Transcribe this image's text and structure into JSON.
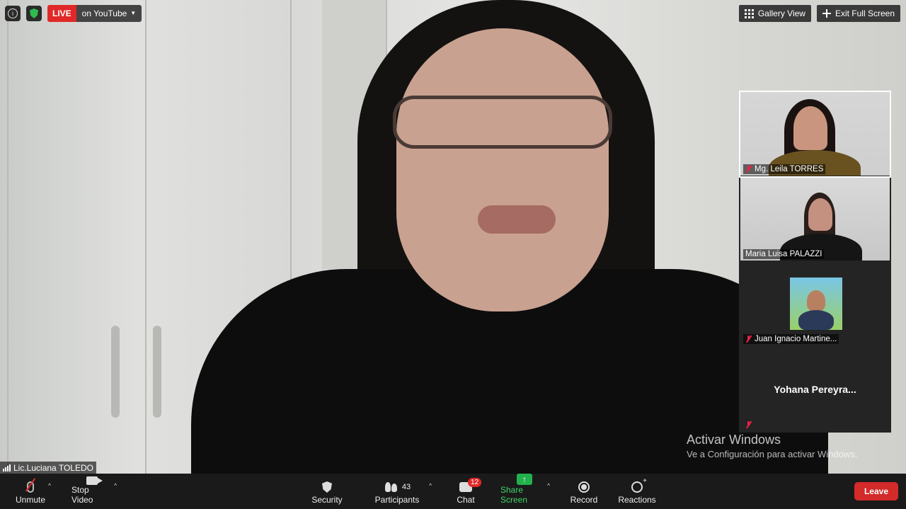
{
  "top": {
    "live_label": "LIVE",
    "stream_target": "on YouTube",
    "gallery_view": "Gallery View",
    "exit_full_screen": "Exit Full Screen"
  },
  "participants_panel": [
    {
      "name": "Mg. Leila TORRES",
      "muted": true,
      "video": true
    },
    {
      "name": "Maria Luisa PALAZZI",
      "muted": false,
      "video": true
    },
    {
      "name": "Juan Ignacio Martine...",
      "muted": true,
      "video": true
    },
    {
      "name": "Yohana  Pereyra...",
      "muted": true,
      "video": false
    }
  ],
  "speaker": {
    "name": "Lic.Luciana TOLEDO"
  },
  "watermark": {
    "line1": "Activar Windows",
    "line2": "Ve a Configuración para activar Windows."
  },
  "toolbar": {
    "unmute": "Unmute",
    "stop_video": "Stop Video",
    "security": "Security",
    "participants": "Participants",
    "participants_count": "43",
    "chat": "Chat",
    "chat_badge": "12",
    "share_screen": "Share Screen",
    "record": "Record",
    "reactions": "Reactions",
    "leave": "Leave"
  },
  "colors": {
    "live": "#e02828",
    "share": "#22b14c",
    "leave": "#d32a2a",
    "shield": "#2dbb4e"
  }
}
